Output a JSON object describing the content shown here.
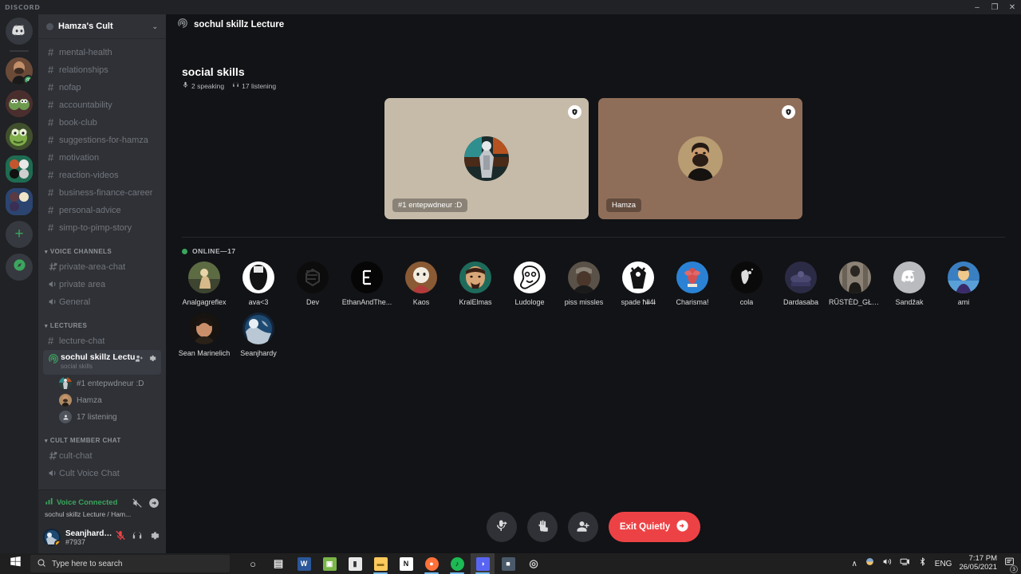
{
  "window": {
    "wordmark": "DISCORD",
    "minimize": "–",
    "maximize": "❐",
    "close": "✕"
  },
  "rail": {
    "home_icon": "discord-home-icon",
    "servers": [
      {
        "name": "hamza-server",
        "colors": [
          "#6b4a38",
          "#8d6a52"
        ],
        "active": true,
        "stage_badge": true
      },
      {
        "name": "frog-server",
        "colors": [
          "#3f2b2b",
          "#5c3a3a"
        ],
        "active": false
      },
      {
        "name": "pepe-server",
        "colors": [
          "#3d4a2a",
          "#6b8c3a"
        ],
        "active": false
      },
      {
        "name": "folder-green",
        "colors": [
          "#1e5c4a",
          "#2a7a5e"
        ],
        "active": true,
        "folder": true
      },
      {
        "name": "folder-blue",
        "colors": [
          "#2a3f6b",
          "#3a5a8c"
        ],
        "active": true,
        "folder": true
      }
    ],
    "add_label": "+",
    "explore_icon": "compass-icon"
  },
  "sidebar": {
    "guild_name": "Hamza's Cult",
    "chevron": "⌄",
    "text_channels": [
      {
        "label": "mental-health",
        "icon": "hash-icon"
      },
      {
        "label": "relationships",
        "icon": "hash-icon"
      },
      {
        "label": "nofap",
        "icon": "hash-icon"
      },
      {
        "label": "accountability",
        "icon": "hash-icon"
      },
      {
        "label": "book-club",
        "icon": "hash-icon"
      },
      {
        "label": "suggestions-for-hamza",
        "icon": "hash-icon"
      },
      {
        "label": "motivation",
        "icon": "hash-icon"
      },
      {
        "label": "reaction-videos",
        "icon": "hash-icon"
      },
      {
        "label": "business-finance-career",
        "icon": "hash-icon"
      },
      {
        "label": "personal-advice",
        "icon": "hash-icon"
      },
      {
        "label": "simp-to-pimp-story",
        "icon": "hash-icon"
      }
    ],
    "voice_category": "VOICE CHANNELS",
    "voice_channels": [
      {
        "label": "private-area-chat",
        "icon": "hash-voice-icon"
      },
      {
        "label": "private area",
        "icon": "speaker-icon"
      },
      {
        "label": "General",
        "icon": "speaker-icon"
      }
    ],
    "lectures_category": "LECTURES",
    "lecture_text_channel": {
      "label": "lecture-chat",
      "icon": "hash-icon"
    },
    "active_stage": {
      "title": "sochul skillz Lecture",
      "subtitle": "social skills",
      "icon": "stage-icon",
      "invite_icon": "person-add-icon",
      "settings_icon": "gear-icon"
    },
    "stage_participants": [
      {
        "name": "#1 entepwdneur :D",
        "avatar": "mech-avatar"
      },
      {
        "name": "Hamza",
        "avatar": "hamza-avatar"
      },
      {
        "name": "17 listening",
        "avatar": "listeners-icon"
      }
    ],
    "cult_category": "CULT MEMBER CHAT",
    "cult_channels": [
      {
        "label": "cult-chat",
        "icon": "hash-voice-icon"
      },
      {
        "label": "Cult Voice Chat",
        "icon": "speaker-icon"
      }
    ]
  },
  "voice_panel": {
    "status": "Voice Connected",
    "signal_icon": "signal-icon",
    "route": "sochul skillz Lecture / Ham...",
    "noise_icon": "noise-suppression-icon",
    "disconnect_icon": "disconnect-icon"
  },
  "user_panel": {
    "username": "Seanjhardy....",
    "tag": "#7937",
    "mic_icon": "mic-muted-icon",
    "headset_icon": "headset-icon",
    "settings_icon": "gear-icon"
  },
  "main": {
    "header_title": "sochul skillz Lecture",
    "header_icon": "stage-icon",
    "stage_title": "social skills",
    "speaking_count": "2 speaking",
    "speaking_icon": "mic-icon",
    "listening_count": "17 listening",
    "listening_icon": "headset-icon",
    "cards": [
      {
        "name": "#1 entepwdneur :D",
        "bg": "#c6bba9",
        "badge_icon": "moderator-shield-icon",
        "avatar": "mech-avatar"
      },
      {
        "name": "Hamza",
        "bg": "#8f6e59",
        "badge_icon": "moderator-shield-icon",
        "avatar": "hamza-avatar"
      }
    ],
    "online_label": "ONLINE—17",
    "members": [
      {
        "name": "Analgagreflex",
        "avatar_kind": "photo-giraffe",
        "colors": [
          "#7d8461",
          "#4a5138"
        ]
      },
      {
        "name": "ava<3",
        "avatar_kind": "art-white",
        "colors": [
          "#ffffff",
          "#1a1a1a"
        ]
      },
      {
        "name": "Dev",
        "avatar_kind": "logo-dark",
        "colors": [
          "#0d0d0d",
          "#2a2a2a"
        ]
      },
      {
        "name": "EthanAndThe...",
        "avatar_kind": "logo-e",
        "colors": [
          "#050505",
          "#141414"
        ]
      },
      {
        "name": "Kaos",
        "avatar_kind": "anime",
        "colors": [
          "#8a5a3a",
          "#d8c2a8"
        ]
      },
      {
        "name": "KralElmas",
        "avatar_kind": "cartoon-man",
        "colors": [
          "#6b3a2a",
          "#c98d6a"
        ]
      },
      {
        "name": "Ludologe",
        "avatar_kind": "meme-face",
        "colors": [
          "#ffffff",
          "#1a1a1a"
        ]
      },
      {
        "name": "piss missles",
        "avatar_kind": "photo-person",
        "colors": [
          "#4a4238",
          "#8a7a66"
        ]
      },
      {
        "name": "spade ħł̶ł4̶ł",
        "avatar_kind": "art-black-white",
        "colors": [
          "#ffffff",
          "#151515"
        ]
      },
      {
        "name": "Charisma!",
        "avatar_kind": "blue-art",
        "colors": [
          "#2b82d4",
          "#d45050"
        ]
      },
      {
        "name": "cola",
        "avatar_kind": "dark-art",
        "colors": [
          "#0a0a0a",
          "#2a2a2a"
        ]
      },
      {
        "name": "Dardasaba",
        "avatar_kind": "purple-art",
        "colors": [
          "#2c2b45",
          "#4a4870"
        ]
      },
      {
        "name": "RÛSTÈD_GŁÀ...",
        "avatar_kind": "photo-gray",
        "colors": [
          "#6b6257",
          "#3a352e"
        ]
      },
      {
        "name": "Sandžak",
        "avatar_kind": "discord-default",
        "colors": [
          "#b9bbbe",
          "#8a8d91"
        ]
      },
      {
        "name": "ami",
        "avatar_kind": "anime-blue",
        "colors": [
          "#3a7fc1",
          "#f0c98a"
        ]
      },
      {
        "name": "Sean Marinelich",
        "avatar_kind": "photo-dark",
        "colors": [
          "#2b2017",
          "#6b5240"
        ]
      },
      {
        "name": "Seanjhardy",
        "avatar_kind": "photo-earth",
        "colors": [
          "#1e3a5c",
          "#7fa8c9"
        ]
      }
    ]
  },
  "controls": {
    "mic_button": {
      "name": "mic-request-icon",
      "label": ""
    },
    "hand_button": {
      "name": "raise-hand-icon",
      "label": ""
    },
    "invite_button": {
      "name": "person-add-icon",
      "label": ""
    },
    "exit_label": "Exit Quietly",
    "exit_icon": "exit-arrow-icon",
    "exit_color": "#ed4245"
  },
  "taskbar": {
    "start_icon": "windows-start-icon",
    "search_placeholder": "Type here to search",
    "search_icon": "search-icon",
    "apps": [
      {
        "name": "cortana-icon",
        "glyph": "○",
        "bg": "transparent",
        "color": "#e6e6e6",
        "active": false,
        "indicator": false
      },
      {
        "name": "task-view-icon",
        "glyph": "▤",
        "bg": "transparent",
        "color": "#e6e6e6",
        "active": false,
        "indicator": false
      },
      {
        "name": "word-icon",
        "glyph": "W",
        "bg": "#2b579a",
        "color": "#ffffff",
        "active": false,
        "indicator": false
      },
      {
        "name": "photos-icon",
        "glyph": "▣",
        "bg": "#7ab648",
        "color": "#ffffff",
        "active": false,
        "indicator": false
      },
      {
        "name": "app-icon",
        "glyph": "▮",
        "bg": "#e8e8e8",
        "color": "#333333",
        "active": false,
        "indicator": false
      },
      {
        "name": "file-explorer-icon",
        "glyph": "▬",
        "bg": "#ffc95c",
        "color": "#8a6a1a",
        "active": false,
        "indicator": true
      },
      {
        "name": "notion-icon",
        "glyph": "N",
        "bg": "#ffffff",
        "color": "#111111",
        "active": false,
        "indicator": false
      },
      {
        "name": "firefox-icon",
        "glyph": "●",
        "bg": "#ff7139",
        "color": "#ffffff",
        "active": false,
        "indicator": true
      },
      {
        "name": "spotify-icon",
        "glyph": "♪",
        "bg": "#1db954",
        "color": "#0a0a0a",
        "active": false,
        "indicator": true
      },
      {
        "name": "discord-icon",
        "glyph": "◑",
        "bg": "#5865f2",
        "color": "#ffffff",
        "active": true,
        "indicator": true
      },
      {
        "name": "steam-icon",
        "glyph": "■",
        "bg": "#4a5a6a",
        "color": "#ffffff",
        "active": false,
        "indicator": false
      },
      {
        "name": "browser-icon",
        "glyph": "◎",
        "bg": "transparent",
        "color": "#d0d0d0",
        "active": false,
        "indicator": false
      }
    ],
    "tray": {
      "chevron": "∧",
      "onedrive_icon": "cloud-icon",
      "volume_icon": "volume-icon",
      "network_icon": "network-icon",
      "bluetooth_icon": "bluetooth-icon",
      "language": "ENG",
      "time": "7:17 PM",
      "date": "26/05/2021",
      "notification_icon": "notifications-icon",
      "notification_count": "3"
    }
  }
}
